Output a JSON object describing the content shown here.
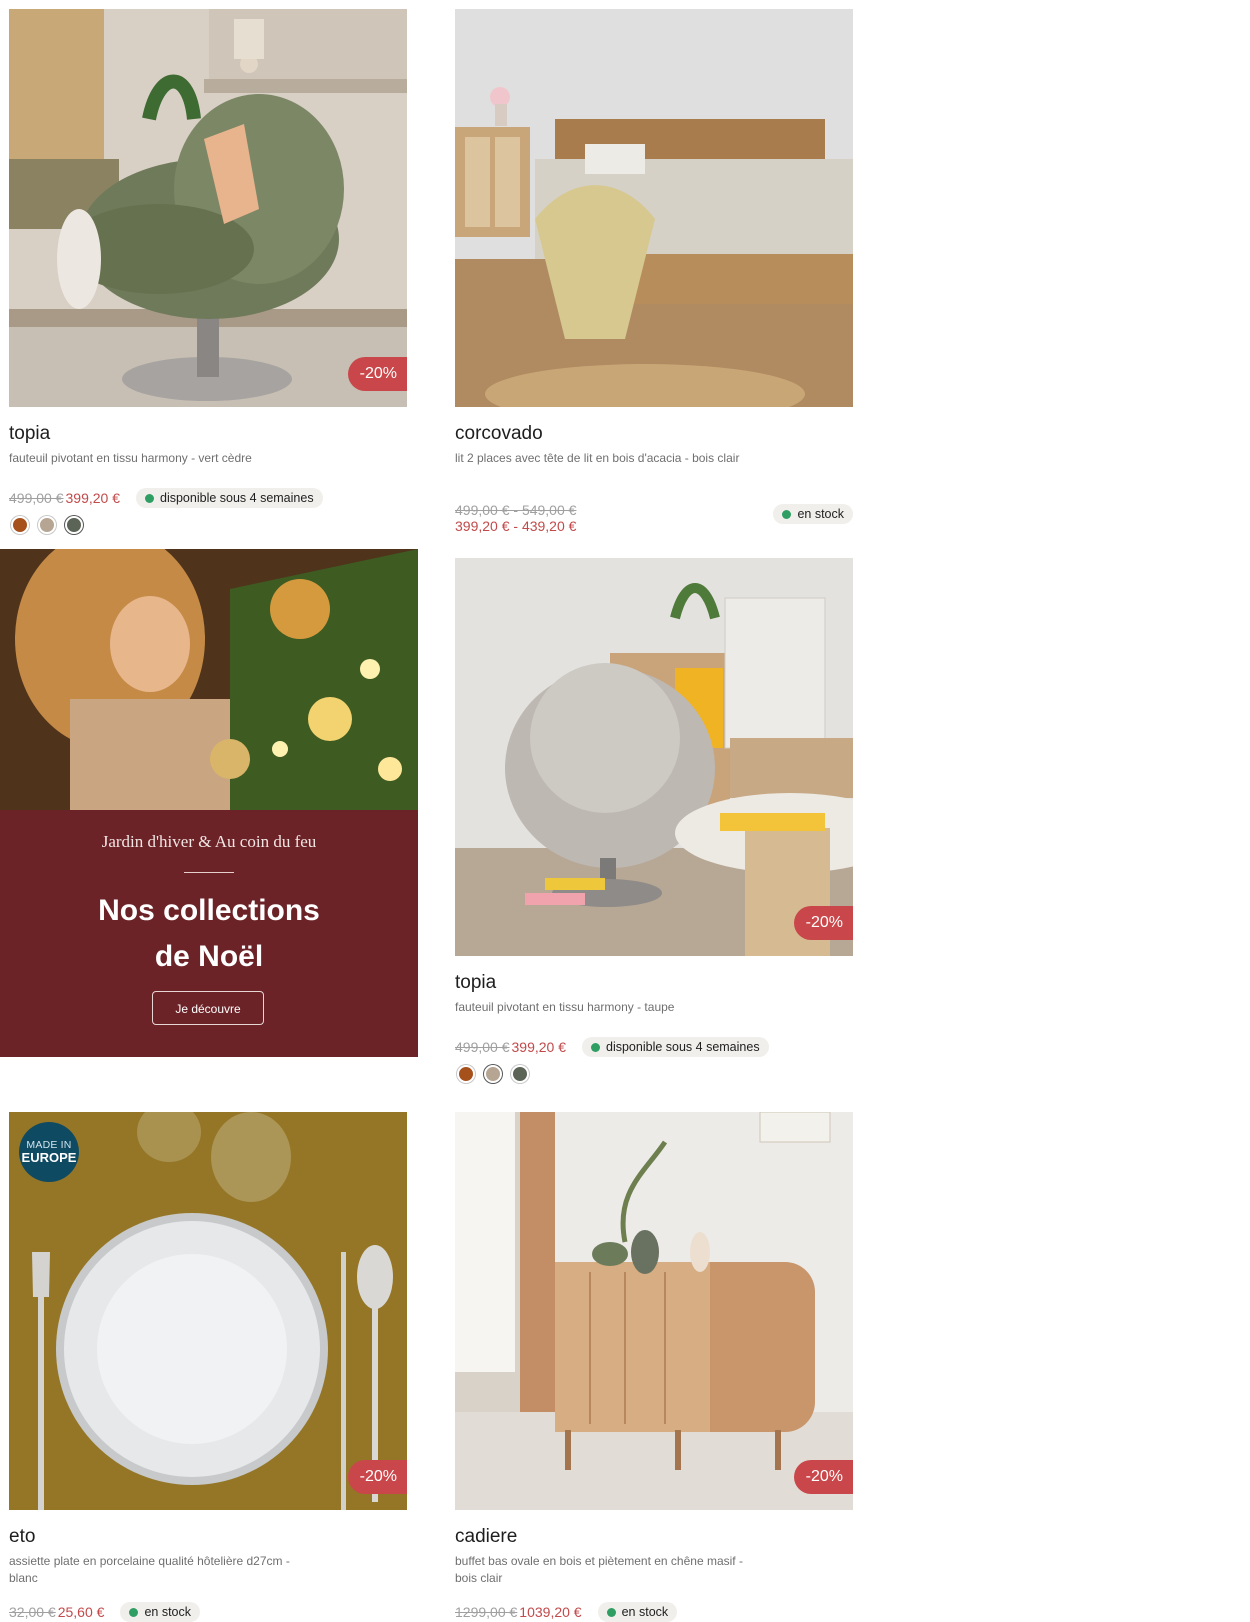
{
  "products": [
    {
      "name": "topia",
      "description": "fauteuil pivotant en tissu harmony - vert cèdre",
      "old_price": "499,00 €",
      "new_price": "399,20 €",
      "availability": "disponible sous 4 semaines",
      "discount": "-20%",
      "swatches": [
        "#a6501c",
        "#b7a593",
        "#5b6457"
      ],
      "selected_swatch": 2
    },
    {
      "name": "corcovado",
      "description": "lit 2 places avec tête de lit en bois d'acacia - bois clair",
      "old_price": "499,00 € - 549,00 €",
      "new_price": "399,20 € - 439,20 €",
      "availability": "en stock"
    },
    {
      "name": "topia",
      "description": "fauteuil pivotant en tissu harmony - taupe",
      "old_price": "499,00 €",
      "new_price": "399,20 €",
      "availability": "disponible sous 4 semaines",
      "discount": "-20%",
      "swatches": [
        "#a6501c",
        "#b7a593",
        "#5b6457"
      ],
      "selected_swatch": 1
    },
    {
      "name": "eto",
      "description": "assiette plate en porcelaine qualité hôtelière d27cm - blanc",
      "old_price": "32,00 €",
      "new_price": "25,60 €",
      "availability": "en stock",
      "discount": "-20%",
      "badge_line1": "MADE IN",
      "badge_line2": "EUROPE"
    },
    {
      "name": "cadiere",
      "description": "buffet bas ovale en bois et piètement en chêne masif - bois clair",
      "old_price": "1299,00 €",
      "new_price": "1039,20 €",
      "availability": "en stock",
      "discount": "-20%"
    }
  ],
  "promo": {
    "subtitle": "Jardin d'hiver & Au coin du feu",
    "title_line1": "Nos collections",
    "title_line2": "de Noël",
    "button": "Je découvre"
  },
  "colors": {
    "accent_red": "#c9474a",
    "promo_bg": "#6c2328",
    "stock_green": "#2f9e63"
  }
}
